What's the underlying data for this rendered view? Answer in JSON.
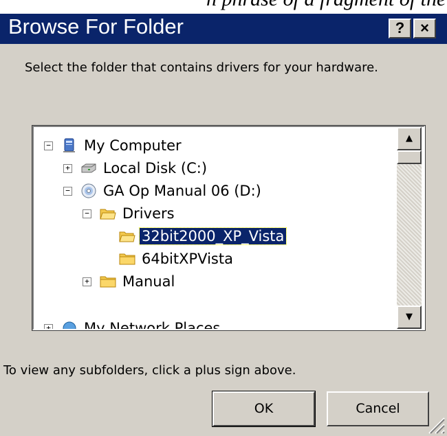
{
  "page_top": {
    "caption_fragment": "n phrase of a fragment of the textual body"
  },
  "dialog": {
    "title": "Browse For Folder",
    "help_label": "?",
    "close_label": "×",
    "instruction": "Select the folder that contains drivers for your hardware.",
    "footer_hint": "To view any subfolders, click a plus sign above.",
    "ok_label": "OK",
    "cancel_label": "Cancel"
  },
  "tree": {
    "items": [
      {
        "label": "My Computer",
        "expander": "−",
        "icon": "my-computer-icon",
        "selected": false
      },
      {
        "label": "Local Disk (C:)",
        "expander": "+",
        "icon": "drive-icon",
        "selected": false
      },
      {
        "label": "GA Op Manual 06 (D:)",
        "expander": "−",
        "icon": "cd-drive-icon",
        "selected": false
      },
      {
        "label": "Drivers",
        "expander": "−",
        "icon": "folder-icon",
        "selected": false
      },
      {
        "label": "32bit2000_XP_Vista",
        "expander": "",
        "icon": "folder-icon",
        "selected": true
      },
      {
        "label": "64bitXPVista",
        "expander": "",
        "icon": "folder-icon",
        "selected": false
      },
      {
        "label": "Manual",
        "expander": "+",
        "icon": "folder-icon",
        "selected": false
      },
      {
        "label": "My Network Places",
        "expander": "+",
        "icon": "network-places-icon",
        "selected": false
      }
    ]
  },
  "scrollbar": {
    "up_glyph": "▲",
    "down_glyph": "▼"
  },
  "colors": {
    "title_bar": "#0a246a",
    "dialog_face": "#d4d0c8",
    "selection": "#0a246a",
    "folder": "#f3c94e"
  }
}
